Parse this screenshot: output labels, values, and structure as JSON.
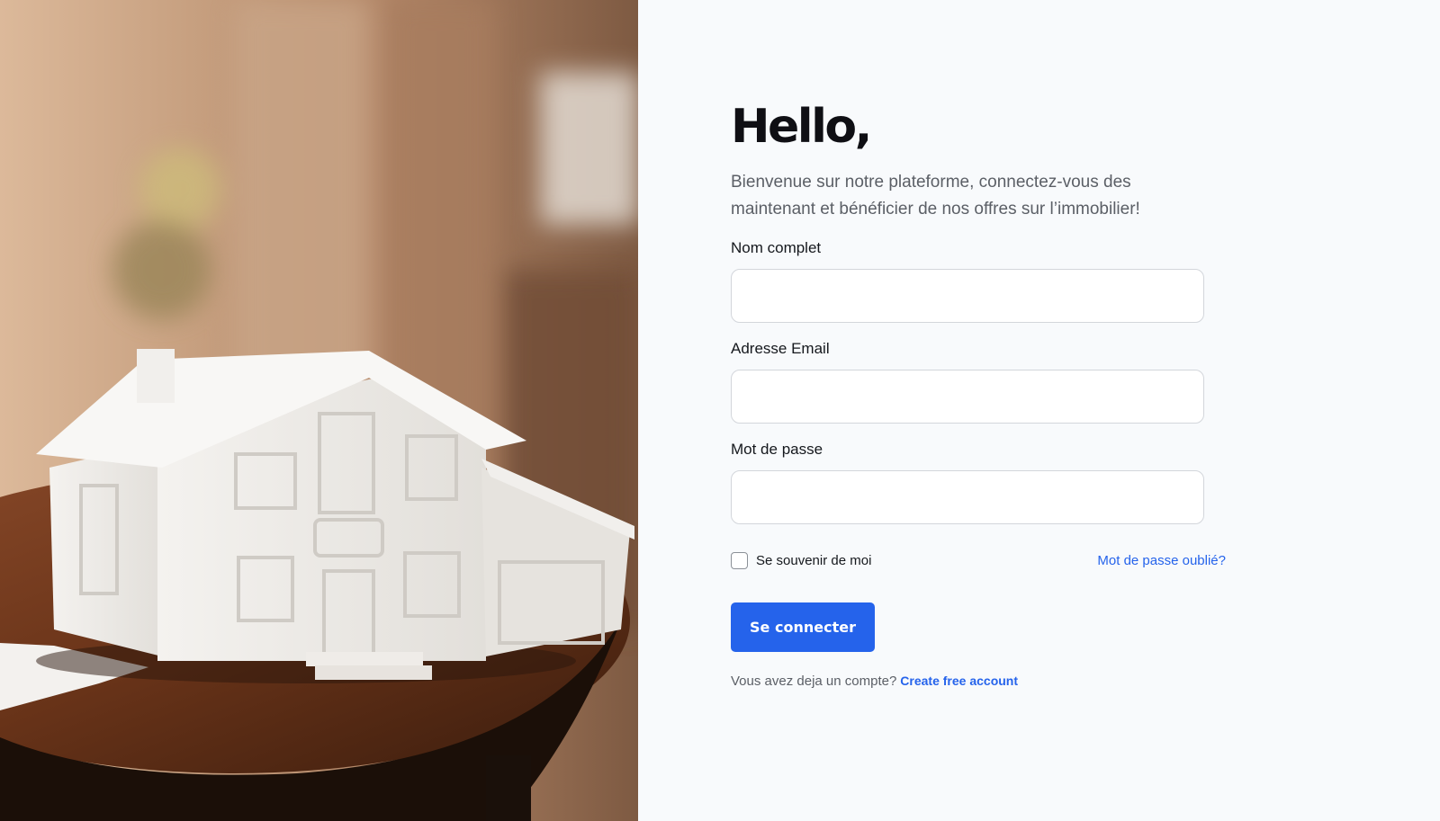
{
  "hero": {
    "image": "house-model-photo"
  },
  "form": {
    "heading": "Hello,",
    "intro": "Bienvenue sur notre plateforme, connectez-vous des maintenant et bénéficier de nos offres sur l’immobilier!",
    "fields": [
      {
        "label": "Nom complet",
        "value": "",
        "placeholder": ""
      },
      {
        "label": "Adresse Email",
        "value": "",
        "placeholder": ""
      },
      {
        "label": "Mot de passe",
        "value": "",
        "placeholder": ""
      }
    ],
    "remember_label": "Se souvenir de moi",
    "remember_checked": false,
    "forgot_label": "Mot de passe oublié?",
    "submit_label": "Se connecter",
    "signup_prompt": "Vous avez deja un compte?",
    "signup_link": "Create free account"
  },
  "colors": {
    "accent": "#2563eb",
    "background": "#f8fafc",
    "heading": "#0f0f14",
    "muted_text": "#5b5f66"
  }
}
